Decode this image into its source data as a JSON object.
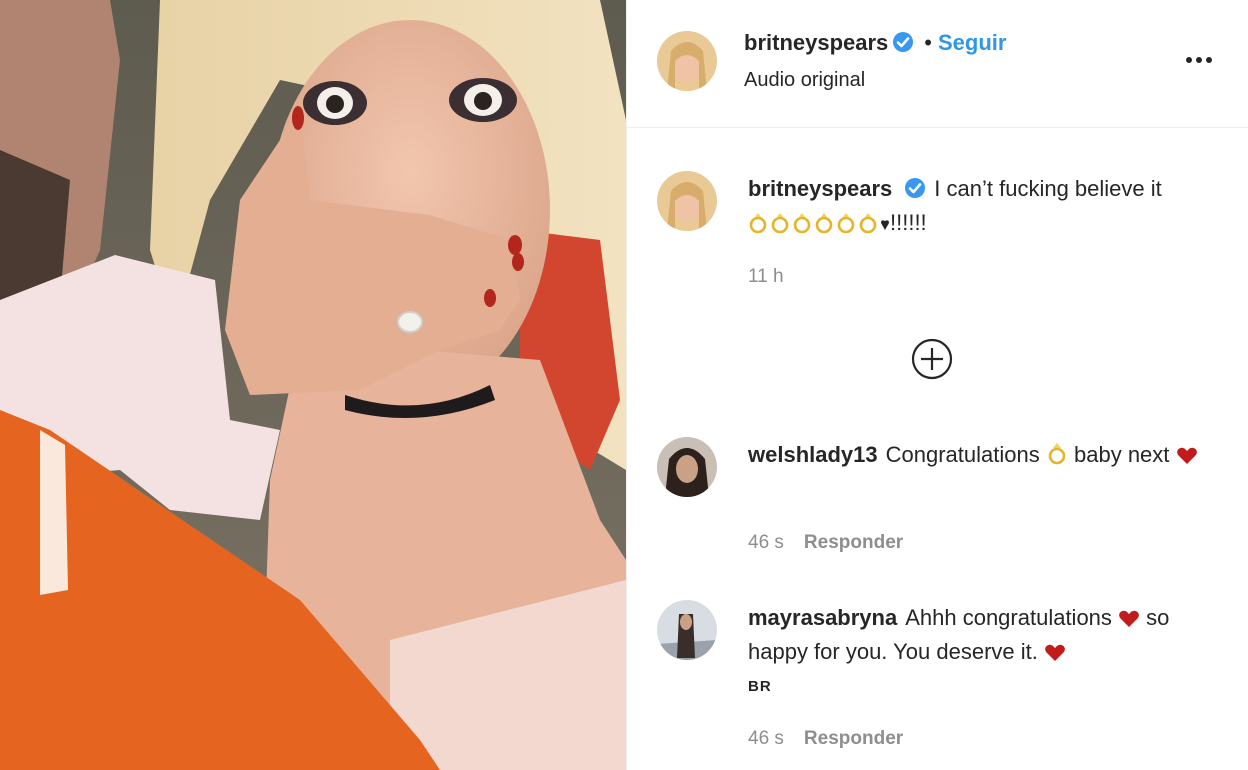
{
  "post": {
    "username": "britneyspears",
    "follow_label": "Seguir",
    "separator": "•",
    "audio_label": "Audio original",
    "caption_text": "I can’t fucking believe it",
    "caption_suffix": "!!!!!!",
    "caption_time": "11 h"
  },
  "comments": [
    {
      "username": "welshlady13",
      "text_before": "Congratulations",
      "text_after": "baby next",
      "time": "46 s",
      "reply_label": "Responder"
    },
    {
      "username": "mayrasabryna",
      "text_before": "Ahhh congratulations",
      "text_middle": "so happy for you. You deserve it.",
      "time": "46 s",
      "reply_label": "Responder"
    }
  ],
  "watermark": "BR",
  "colors": {
    "link_blue": "#2f98e6",
    "verified_blue": "#3897f0",
    "heart_red": "#c21b1b",
    "muted_gray": "#8e8e8e"
  },
  "icons": {
    "verified": "verified-badge-icon",
    "more": "more-options-icon",
    "load_more": "plus-circle-icon",
    "ring": "ring-emoji",
    "heart": "red-heart-emoji"
  }
}
